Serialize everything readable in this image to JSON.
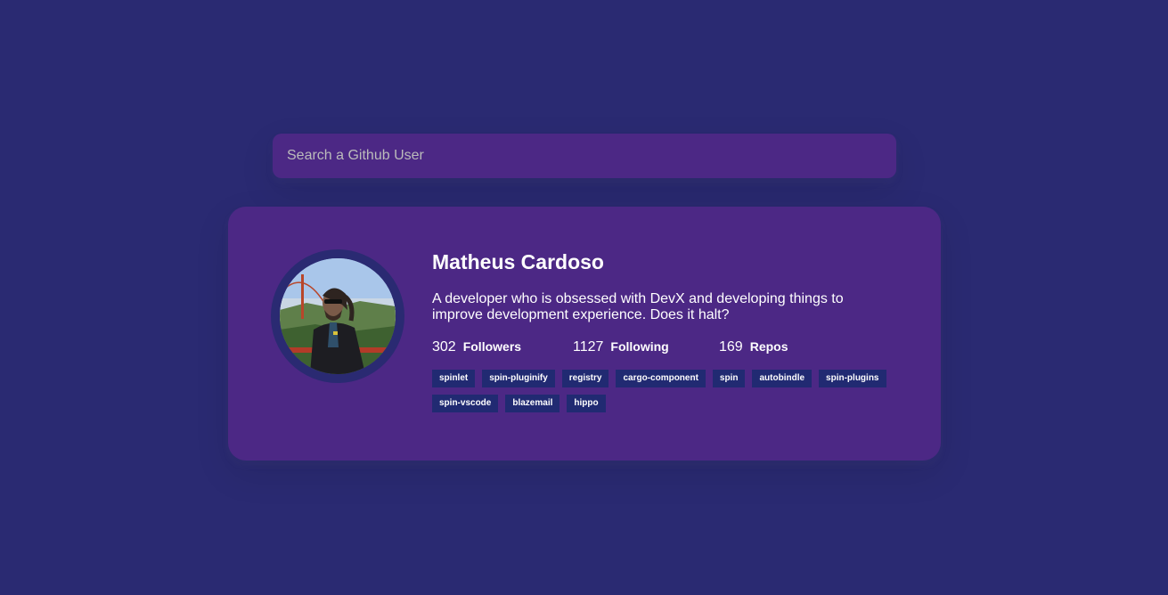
{
  "search": {
    "placeholder": "Search a Github User",
    "value": ""
  },
  "profile": {
    "name": "Matheus Cardoso",
    "bio": "A developer who is obsessed with DevX and developing things to improve development experience. Does it halt?",
    "avatar_alt": "avatar",
    "stats": {
      "followers_count": "302",
      "followers_label": "Followers",
      "following_count": "1127",
      "following_label": "Following",
      "repos_count": "169",
      "repos_label": "Repos"
    },
    "repos": [
      "spinlet",
      "spin-pluginify",
      "registry",
      "cargo-component",
      "spin",
      "autobindle",
      "spin-plugins",
      "spin-vscode",
      "blazemail",
      "hippo"
    ]
  },
  "colors": {
    "background": "#2a2a72",
    "card": "#4c2885",
    "repo_badge": "#212a72",
    "text": "#ffffff"
  }
}
